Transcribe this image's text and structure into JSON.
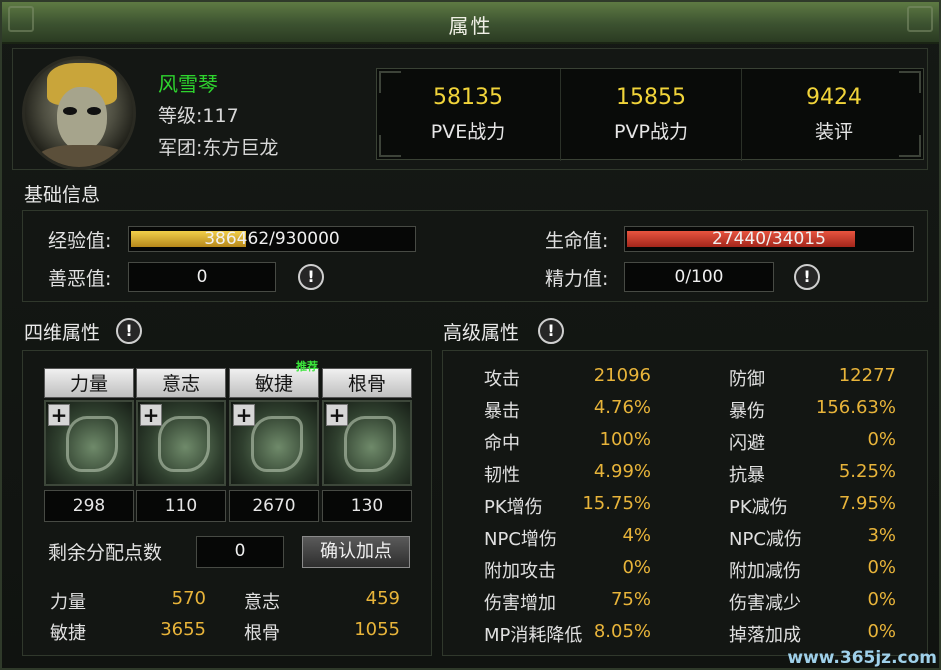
{
  "window": {
    "title": "属性"
  },
  "profile": {
    "name": "风雪琴",
    "level_text": "等级:117",
    "guild_text": "军团:东方巨龙",
    "stats": [
      {
        "value": "58135",
        "label": "PVE战力"
      },
      {
        "value": "15855",
        "label": "PVP战力"
      },
      {
        "value": "9424",
        "label": "装评"
      }
    ]
  },
  "basic": {
    "title": "基础信息",
    "exp": {
      "label": "经验值:",
      "text": "386462/930000",
      "fraction": 0.4156
    },
    "hp": {
      "label": "生命值:",
      "text": "27440/34015",
      "fraction": 0.8067
    },
    "karma": {
      "label": "善恶值:",
      "value": "0"
    },
    "energy": {
      "label": "精力值:",
      "value": "0/100"
    }
  },
  "four_dim": {
    "title": "四维属性",
    "recommend_text": "推荐",
    "attrs": [
      {
        "name": "力量",
        "value": "298"
      },
      {
        "name": "意志",
        "value": "110"
      },
      {
        "name": "敏捷",
        "value": "2670"
      },
      {
        "name": "根骨",
        "value": "130"
      }
    ],
    "remaining_label": "剩余分配点数",
    "remaining_value": "0",
    "confirm_label": "确认加点",
    "summary": [
      {
        "label": "力量",
        "value": "570"
      },
      {
        "label": "意志",
        "value": "459"
      },
      {
        "label": "敏捷",
        "value": "3655"
      },
      {
        "label": "根骨",
        "value": "1055"
      }
    ]
  },
  "advanced": {
    "title": "高级属性",
    "left": [
      {
        "label": "攻击",
        "value": "21096"
      },
      {
        "label": "暴击",
        "value": "4.76%"
      },
      {
        "label": "命中",
        "value": "100%"
      },
      {
        "label": "韧性",
        "value": "4.99%"
      },
      {
        "label": "PK增伤",
        "value": "15.75%"
      },
      {
        "label": "NPC增伤",
        "value": "4%"
      },
      {
        "label": "附加攻击",
        "value": "0%"
      },
      {
        "label": "伤害增加",
        "value": "75%"
      },
      {
        "label": "MP消耗降低",
        "value": "8.05%"
      }
    ],
    "right": [
      {
        "label": "防御",
        "value": "12277"
      },
      {
        "label": "暴伤",
        "value": "156.63%"
      },
      {
        "label": "闪避",
        "value": "0%"
      },
      {
        "label": "抗暴",
        "value": "5.25%"
      },
      {
        "label": "PK减伤",
        "value": "7.95%"
      },
      {
        "label": "NPC减伤",
        "value": "3%"
      },
      {
        "label": "附加减伤",
        "value": "0%"
      },
      {
        "label": "伤害减少",
        "value": "0%"
      },
      {
        "label": "掉落加成",
        "value": "0%"
      }
    ]
  },
  "icons": {
    "info": "!",
    "plus": "+"
  },
  "watermark": "www.365jz.com"
}
